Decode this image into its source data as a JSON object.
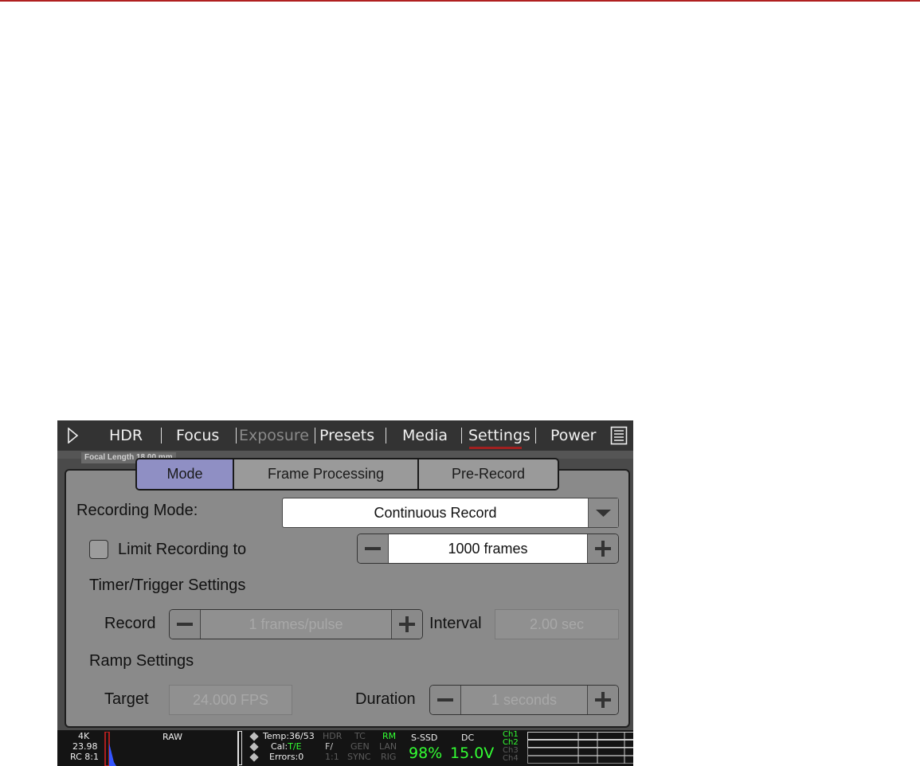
{
  "menu": {
    "items": [
      {
        "label": "HDR",
        "enabled": true
      },
      {
        "label": "Focus",
        "enabled": true
      },
      {
        "label": "Exposure",
        "enabled": false
      },
      {
        "label": "Presets",
        "enabled": true
      },
      {
        "label": "Media",
        "enabled": true
      },
      {
        "label": "Settings",
        "enabled": true,
        "active": true
      },
      {
        "label": "Power",
        "enabled": true
      }
    ]
  },
  "overlay": {
    "focal_label": "Focal Length 18.00 mm"
  },
  "tabs": [
    {
      "label": "Mode",
      "active": true
    },
    {
      "label": "Frame Processing",
      "active": false
    },
    {
      "label": "Pre-Record",
      "active": false
    }
  ],
  "mode": {
    "recording_mode_label": "Recording Mode:",
    "recording_mode_value": "Continuous Record",
    "limit_label": "Limit Recording to",
    "limit_checked": false,
    "limit_value": "1000 frames",
    "timer_heading": "Timer/Trigger Settings",
    "record_label": "Record",
    "record_value": "1 frames/pulse",
    "interval_label": "Interval",
    "interval_value": "2.00 sec",
    "ramp_heading": "Ramp Settings",
    "target_label": "Target",
    "target_value": "24.000 FPS",
    "duration_label": "Duration",
    "duration_value": "1 seconds"
  },
  "status": {
    "res": "4K",
    "fps": "23.98",
    "rc": "RC 8:1",
    "raw": "RAW",
    "temp": "Temp:36/53",
    "cal_prefix": "Cal:",
    "cal_value": "T/E",
    "errors": "Errors:0",
    "hdr": "HDR",
    "f": "F/",
    "ratio": "1:1",
    "tc": "TC",
    "gen": "GEN",
    "sync": "SYNC",
    "rm": "RM",
    "lan": "LAN",
    "rig": "RIG",
    "media_label": "S-SSD",
    "media_pct": "98%",
    "power_label": "DC",
    "power_value": "15.0V",
    "channels": [
      "Ch1",
      "Ch2",
      "Ch3",
      "Ch4"
    ]
  },
  "colors": {
    "active_tab": "#8f8fc4",
    "menu_underline": "#a02020",
    "status_green": "#33ff33",
    "top_rule": "#b02020"
  }
}
